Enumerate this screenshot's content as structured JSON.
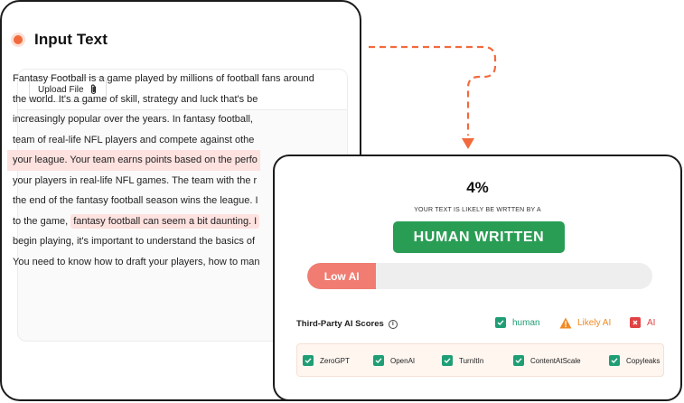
{
  "input": {
    "title": "Input Text",
    "upload_label": "Upload File",
    "lines": [
      "Fantasy Football is a game played by millions of football fans around",
      "the world. It's a game of skill, strategy and luck that's be",
      "increasingly popular over the years. In fantasy football,",
      "team of real-life NFL players and compete against othe",
      "your league. Your team earns points based on the perfo",
      "your players in real-life NFL games. The team with the r",
      "the end of the fantasy football season wins the league. I",
      "to the game, ",
      "fantasy football can seem a bit daunting. I",
      "begin playing, it's important to understand the basics of",
      "You need to know how to draft your players, how to man"
    ]
  },
  "result": {
    "percent": "4%",
    "subtitle": "YOUR TEXT IS LIKELY BE WRTTEN BY A",
    "verdict": "HUMAN WRITTEN",
    "bar_label": "Low AI",
    "ai_fraction": 0.2,
    "third_party_label": "Third-Party AI Scores",
    "legend": {
      "human": "human",
      "likely_ai": "Likely AI",
      "ai": "AI"
    },
    "detectors": [
      "ZeroGPT",
      "OpenAI",
      "TurnItIn",
      "ContentAtScale",
      "Copyleaks"
    ]
  },
  "colors": {
    "accent": "#f26a3c",
    "human_green": "#2a9d55",
    "check_green": "#1f9e75",
    "low_ai": "#f07c72",
    "highlight": "#fde2e0"
  },
  "icons": {
    "paperclip": "paperclip-icon",
    "info": "info-icon",
    "warning": "warning-icon",
    "check": "check-icon",
    "close": "close-icon"
  }
}
